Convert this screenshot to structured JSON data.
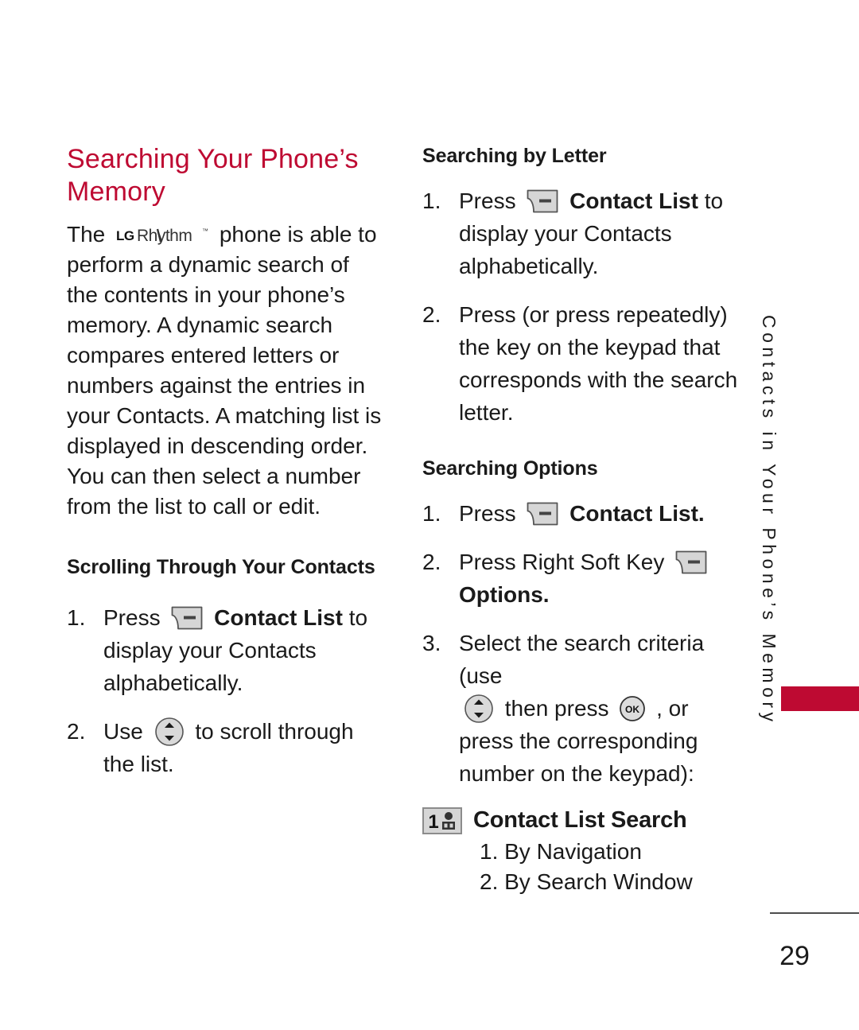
{
  "page": {
    "number": "29",
    "running_head": "Contacts in Your Phone’s Memory",
    "tab_color": "#BE0A32",
    "heading_color": "#BE0A32"
  },
  "left_column": {
    "title": "Searching Your Phone’s Memory",
    "intro_before_logo": "The",
    "logo_text": "LG Rhythm™",
    "intro_after_logo": "phone is able to perform a dynamic search of the contents in your phone’s memory. A dynamic search compares entered letters or numbers against the entries in your Contacts. A matching list is displayed in descending order. You can then select a number from the list to call or edit.",
    "section": {
      "heading": "Scrolling Through Your Contacts",
      "steps": [
        {
          "num": "1.",
          "prefix": "Press",
          "icon": "soft-key-icon",
          "bold_label": "Contact List",
          "suffix": "to display your Contacts alphabetically."
        },
        {
          "num": "2.",
          "prefix": "Use",
          "icon": "navigation-wheel-icon",
          "bold_label": "",
          "suffix": "to scroll through the list."
        }
      ]
    }
  },
  "right_column": {
    "section_letter": {
      "heading": "Searching by Letter",
      "steps": [
        {
          "num": "1.",
          "prefix": "Press",
          "icon": "soft-key-icon",
          "bold_label": "Contact List",
          "suffix": "to display your Contacts alphabetically."
        },
        {
          "num": "2.",
          "prefix": "Press (or press repeatedly) the key on the keypad that corresponds with the search letter.",
          "icon": "",
          "bold_label": "",
          "suffix": ""
        }
      ]
    },
    "section_options": {
      "heading": "Searching Options",
      "steps": [
        {
          "num": "1.",
          "prefix": "Press",
          "icon": "soft-key-icon",
          "bold_label": "Contact List.",
          "suffix": ""
        },
        {
          "num": "2.",
          "prefix": "Press Right Soft Key",
          "icon": "soft-key-icon",
          "bold_label": "Options.",
          "suffix": ""
        },
        {
          "num": "3.",
          "prefix": "Select the search criteria (use",
          "icon": "navigation-wheel-icon",
          "mid": "then press",
          "icon2": "ok-key-icon",
          "suffix": ", or press the corresponding number on the keypad):"
        }
      ],
      "keypad_item": {
        "key_label": "1",
        "key_icon": "voicemail-icon",
        "title": "Contact List Search",
        "options": [
          "1. By Navigation",
          "2. By Search Window"
        ]
      }
    }
  }
}
